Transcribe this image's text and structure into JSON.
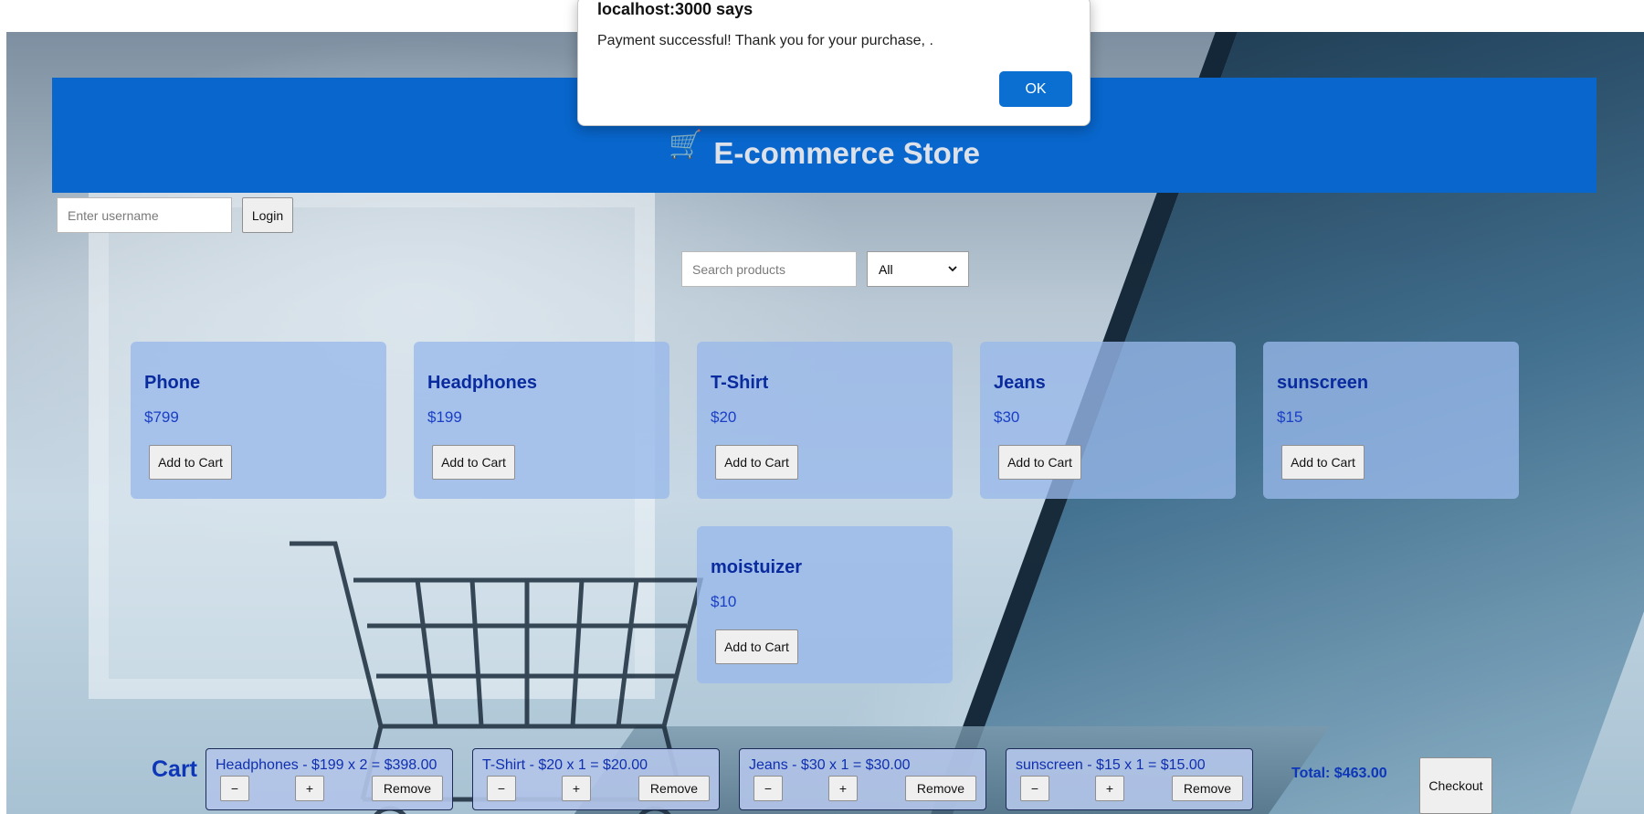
{
  "header": {
    "icon": "shopping-cart-icon",
    "title": "E-commerce Store"
  },
  "login": {
    "username_placeholder": "Enter username",
    "username_value": "",
    "login_label": "Login"
  },
  "search": {
    "placeholder": "Search products",
    "value": "",
    "category_selected": "All"
  },
  "products": [
    {
      "name": "Phone",
      "price": "$799",
      "button": "Add to Cart"
    },
    {
      "name": "Headphones",
      "price": "$199",
      "button": "Add to Cart"
    },
    {
      "name": "T-Shirt",
      "price": "$20",
      "button": "Add to Cart"
    },
    {
      "name": "Jeans",
      "price": "$30",
      "button": "Add to Cart"
    },
    {
      "name": "sunscreen",
      "price": "$15",
      "button": "Add to Cart"
    },
    {
      "name": "moistuizer",
      "price": "$10",
      "button": "Add to Cart"
    }
  ],
  "cart": {
    "title": "Cart",
    "items": [
      {
        "line": "Headphones - $199 x 2 = $398.00",
        "minus": "−",
        "plus": "+",
        "remove": "Remove"
      },
      {
        "line": "T-Shirt - $20 x 1 = $20.00",
        "minus": "−",
        "plus": "+",
        "remove": "Remove"
      },
      {
        "line": "Jeans - $30 x 1 = $30.00",
        "minus": "−",
        "plus": "+",
        "remove": "Remove"
      },
      {
        "line": "sunscreen - $15 x 1 = $15.00",
        "minus": "−",
        "plus": "+",
        "remove": "Remove"
      }
    ],
    "total": "Total: $463.00",
    "checkout_label": "Checkout"
  },
  "dialog": {
    "title": "localhost:3000 says",
    "message": "Payment successful! Thank you for your purchase, .",
    "ok_label": "OK"
  },
  "colors": {
    "header": "#0866cc",
    "accent_text": "#0d36b8",
    "dialog_button": "#0b6fd2"
  }
}
